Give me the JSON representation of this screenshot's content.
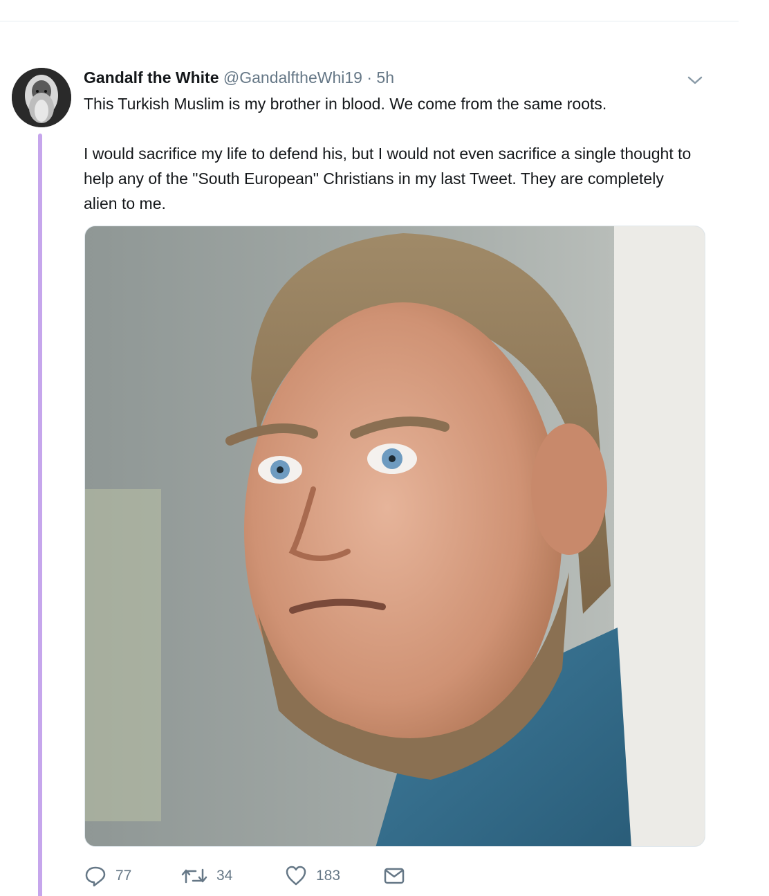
{
  "tweet": {
    "author": {
      "display_name": "Gandalf the White",
      "handle": "@GandalftheWhi19",
      "separator": "·",
      "time": "5h"
    },
    "text_paragraphs": [
      "This Turkish Muslim is my brother in blood. We come from the same roots.",
      "I would sacrifice my life to defend his, but I would not even sacrifice a single thought to help any of the \"South European\" Christians in my last Tweet. They are completely alien to me."
    ],
    "actions": {
      "replies": "77",
      "retweets": "34",
      "likes": "183"
    }
  },
  "icons": {
    "reply": "reply-icon",
    "retweet": "retweet-icon",
    "like": "heart-icon",
    "dm": "envelope-icon",
    "more": "chevron-down-icon"
  },
  "colors": {
    "thread_line": "#c6a6ec",
    "secondary_text": "#657786",
    "primary_text": "#14171a"
  }
}
